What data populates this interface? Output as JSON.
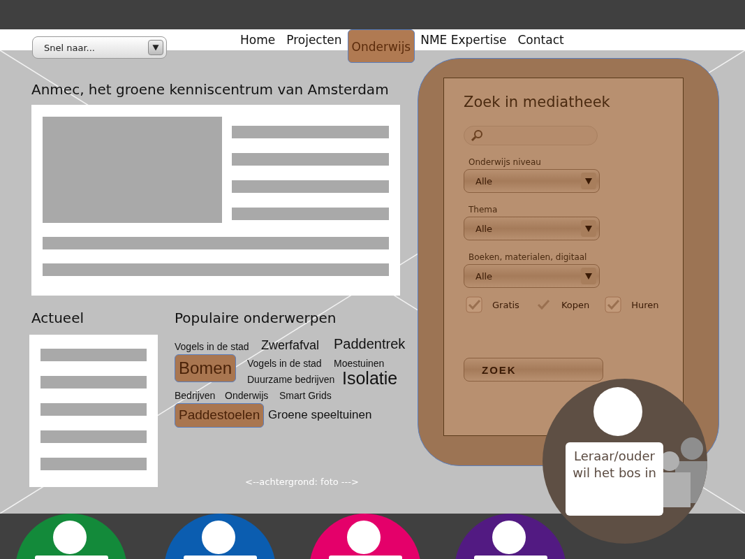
{
  "quick_nav": {
    "value": "Snel naar..."
  },
  "nav": [
    {
      "label": "Home",
      "selected": false
    },
    {
      "label": "Projecten",
      "selected": false
    },
    {
      "label": "Onderwijs",
      "selected": true
    },
    {
      "label": "NME Expertise",
      "selected": false
    },
    {
      "label": "Contact",
      "selected": false
    }
  ],
  "page_title": "Anmec, het groene kenniscentrum van Amsterdam",
  "news": {
    "title": "Actueel"
  },
  "topics": {
    "title": "Populaire onderwerpen",
    "tags": [
      {
        "label": "Vogels in de stad",
        "highlighted": false
      },
      {
        "label": "Zwerfafval",
        "highlighted": false
      },
      {
        "label": "Paddentrek",
        "highlighted": false
      },
      {
        "label": "Bomen",
        "highlighted": true
      },
      {
        "label": "Vogels in de stad",
        "highlighted": false
      },
      {
        "label": "Moestuinen",
        "highlighted": false
      },
      {
        "label": "Duurzame bedrijven",
        "highlighted": false
      },
      {
        "label": "Isolatie",
        "highlighted": false
      },
      {
        "label": "Bedrijven",
        "highlighted": false
      },
      {
        "label": "Onderwijs",
        "highlighted": false
      },
      {
        "label": "Smart Grids",
        "highlighted": false
      },
      {
        "label": "Paddestoelen",
        "highlighted": true
      },
      {
        "label": "Groene speeltuinen",
        "highlighted": false
      }
    ]
  },
  "background_note": "<--achtergrond: foto --->",
  "search_panel": {
    "title": "Zoek in mediatheek",
    "filters": [
      {
        "label": "Onderwijs niveau",
        "value": "Alle"
      },
      {
        "label": "Thema",
        "value": "Alle"
      },
      {
        "label": "Boeken, materialen, digitaal",
        "value": "Alle"
      }
    ],
    "options": [
      {
        "label": "Gratis",
        "kind": "box",
        "checked": true
      },
      {
        "label": "Kopen",
        "kind": "tick",
        "checked": true
      },
      {
        "label": "Huren",
        "kind": "box",
        "checked": true
      }
    ],
    "button": "ZOEK"
  },
  "persona": {
    "caption": "Leraar/ouder wil het bos in"
  },
  "personas": [
    {
      "color": "#138a3a"
    },
    {
      "color": "#0b5db0"
    },
    {
      "color": "#e4006a"
    },
    {
      "color": "#521a82"
    }
  ]
}
